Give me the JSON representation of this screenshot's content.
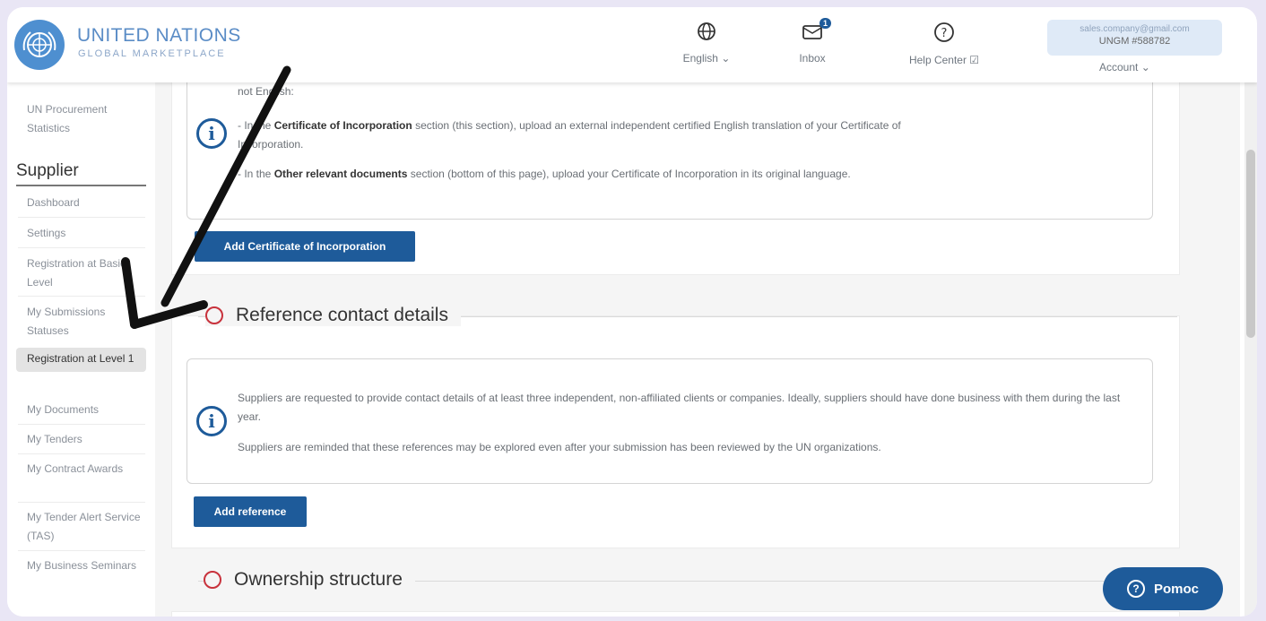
{
  "header": {
    "brand_title": "UNITED NATIONS",
    "brand_subtitle": "GLOBAL MARKETPLACE",
    "language_label": "English ⌄",
    "inbox_label": "Inbox",
    "inbox_badge": "1",
    "help_label": "Help Center ☑",
    "account_email": "sales.company@gmail.com",
    "account_id": "UNGM #588782",
    "account_label": "Account ⌄",
    "icons": {
      "language": "globe-icon",
      "inbox": "inbox-icon",
      "help": "help-circle-icon"
    }
  },
  "sidebar": {
    "top_item": "UN Procurement Statistics",
    "section_heading": "Supplier",
    "items": [
      {
        "label": "Dashboard"
      },
      {
        "label": "Settings"
      },
      {
        "label": "Registration at Basic Level"
      },
      {
        "label": "My Submissions Statuses"
      },
      {
        "label": "Registration at Level 1",
        "active": true
      },
      {
        "label": "My Documents"
      },
      {
        "label": "My Tenders"
      },
      {
        "label": "My Contract Awards"
      },
      {
        "label": "My Tender Alert Service (TAS)"
      },
      {
        "label": "My Business Seminars"
      }
    ]
  },
  "main": {
    "cert_section": {
      "line_top": "not English:",
      "line1_prefix": "- In the",
      "line1_bold": "Certificate of Incorporation",
      "line1_rest": "section (this section), upload an external independent certified English translation of your Certificate of",
      "line1_cont": "Incorporation.",
      "line2_prefix": "- In the",
      "line2_bold": "Other relevant documents",
      "line2_rest": "section (bottom of this page), upload your Certificate of Incorporation in its original language.",
      "button": "Add Certificate of Incorporation"
    },
    "reference_section": {
      "title": "Reference contact details",
      "para1": "Suppliers are requested to provide contact details of at least three independent, non-affiliated clients or companies. Ideally, suppliers should have done business with them during the last year.",
      "para2": "Suppliers are reminded that these references may be explored even after your submission has been reviewed by the UN organizations.",
      "button": "Add reference"
    },
    "ownership_section": {
      "title": "Ownership structure"
    }
  },
  "help_button": "Pomoc",
  "colors": {
    "primary": "#1e5b9a",
    "required": "#c8323c",
    "brand": "#5a8cc6"
  }
}
